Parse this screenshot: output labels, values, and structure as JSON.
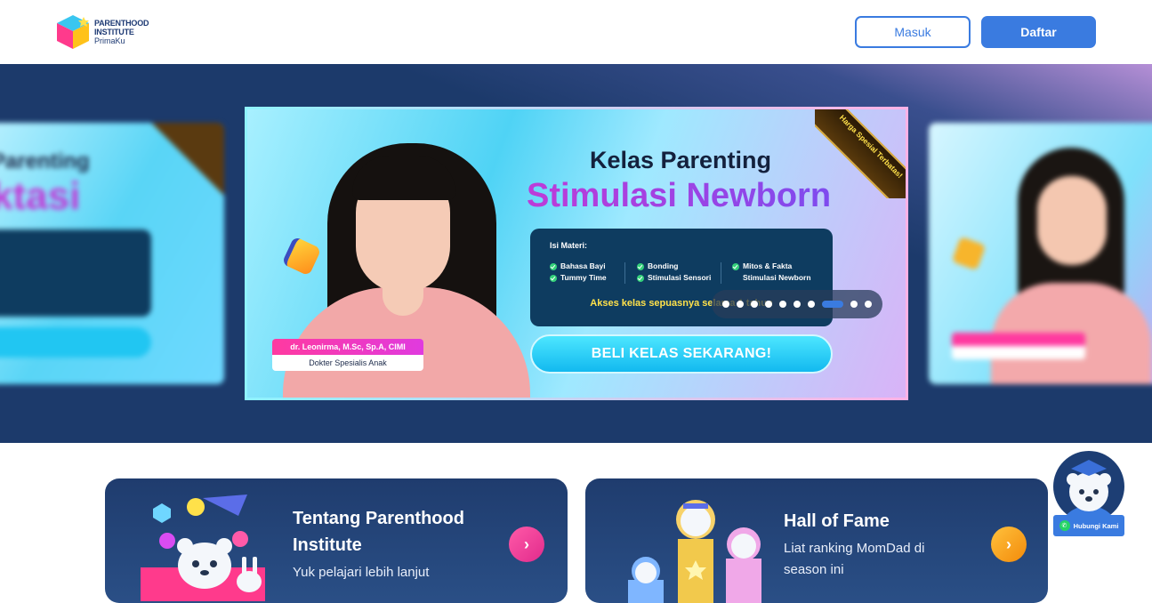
{
  "header": {
    "logo": {
      "line1": "PARENTHOOD",
      "line2": "INSTITUTE",
      "line3": "PrimaKu"
    },
    "login_label": "Masuk",
    "register_label": "Daftar"
  },
  "banner": {
    "title_line1": "Kelas Parenting",
    "title_line2": "Stimulasi Newborn",
    "ribbon": "Harga Spesial Terbatas!",
    "materi_title": "Isi Materi:",
    "materi": [
      [
        "Bahasa Bayi",
        "Tummy Time"
      ],
      [
        "Bonding",
        "Stimulasi Sensori"
      ],
      [
        "Mitos & Fakta",
        "Stimulasi Newborn"
      ]
    ],
    "access_text": "Akses kelas sepuasnya selama 1 tahun",
    "cta_label": "BELI KELAS SEKARANG!",
    "doctor_name": "dr. Leonirma, M.Sc, Sp.A, CIMI",
    "doctor_role": "Dokter Spesialis Anak",
    "carousel": {
      "total": 10,
      "active": 8
    }
  },
  "side_banner_left": {
    "title_line1": "Parenting",
    "title_line2": "ktasi"
  },
  "cards": {
    "about": {
      "title": "Tentang Parenthood Institute",
      "subtitle": "Yuk pelajari lebih lanjut",
      "arrow": "›"
    },
    "fame": {
      "title": "Hall of Fame",
      "subtitle": "Liat ranking MomDad di season ini",
      "arrow": "›"
    }
  },
  "help": {
    "label": "Hubungi Kami"
  },
  "colors": {
    "primary": "#3a7be0",
    "navy": "#1c3a6b",
    "accent_pink": "#e12b8c",
    "accent_orange": "#f38a0a"
  }
}
